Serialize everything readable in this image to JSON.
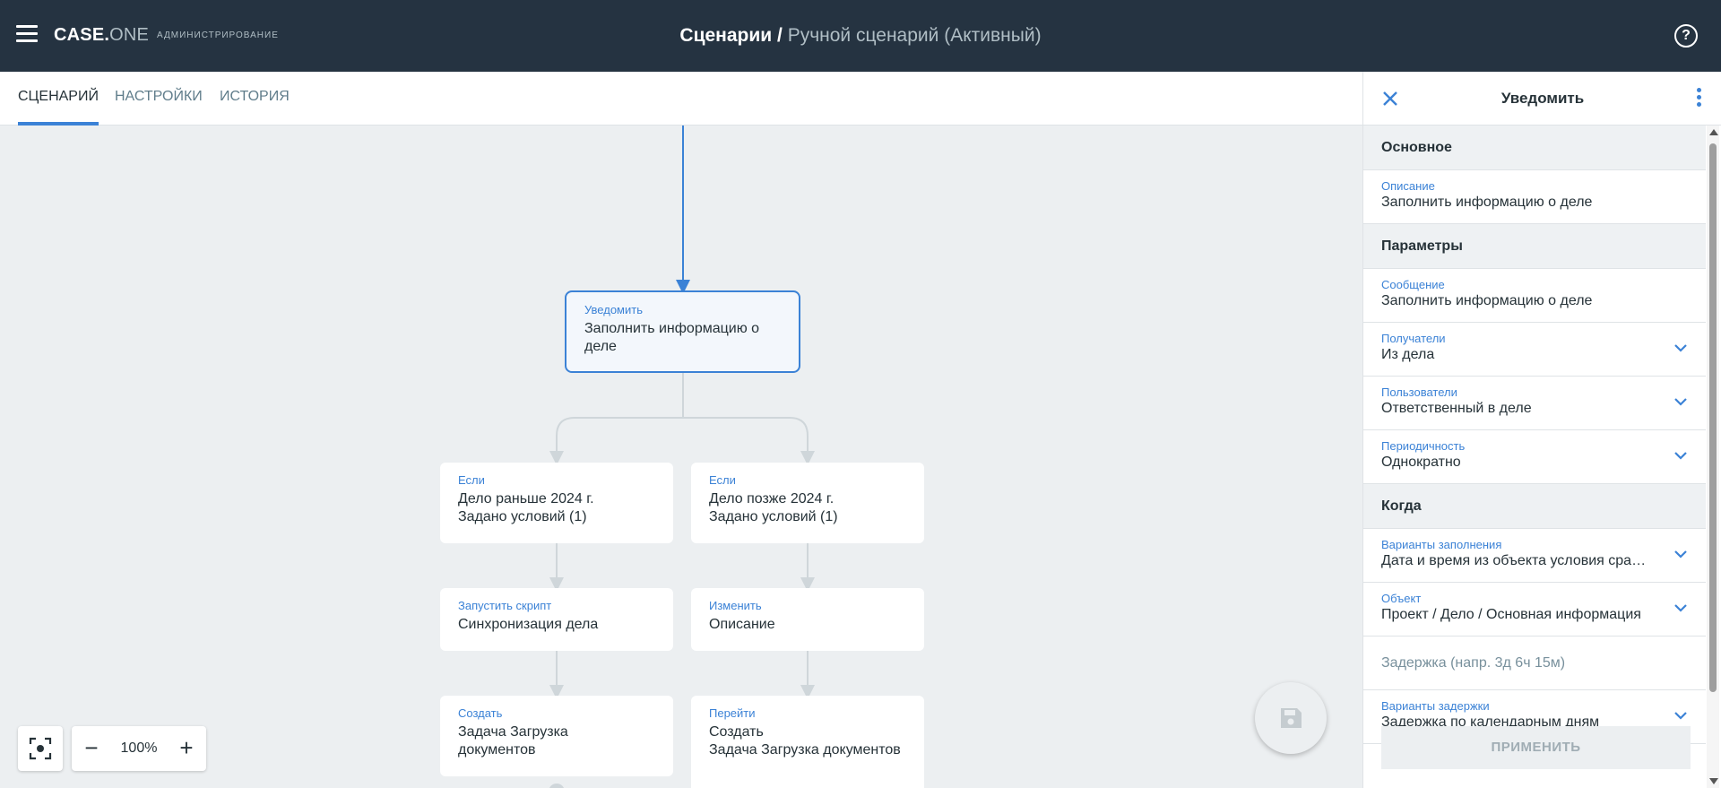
{
  "header": {
    "logo_main": "CASE.",
    "logo_sub": "ONE",
    "section": "АДМИНИСТРИРОВАНИЕ",
    "title_root": "Сценарии",
    "title_sep": " / ",
    "title_sub": "Ручной сценарий (Активный)",
    "menu_icon": "hamburger-icon",
    "help_icon": "help-icon",
    "help_glyph": "?"
  },
  "tabs": [
    {
      "label": "СЦЕНАРИЙ",
      "active": true
    },
    {
      "label": "НАСТРОЙКИ",
      "active": false
    },
    {
      "label": "ИСТОРИЯ",
      "active": false
    }
  ],
  "flow": {
    "nodes": [
      {
        "type": "Уведомить",
        "text": "Заполнить информацию о деле",
        "selected": true
      },
      {
        "type": "Если",
        "text": "Дело раньше 2024 г.\nЗадано условий (1)"
      },
      {
        "type": "Если",
        "text": "Дело позже 2024 г.\nЗадано условий (1)"
      },
      {
        "type": "Запустить скрипт",
        "text": "Синхронизация дела"
      },
      {
        "type": "Изменить",
        "text": "Описание"
      },
      {
        "type": "Создать",
        "text": "Задача Загрузка документов"
      },
      {
        "type": "Перейти",
        "text": "Создать\nЗадача Загрузка документов"
      }
    ]
  },
  "zoom": {
    "level": "100%",
    "minus": "−",
    "plus": "+",
    "fit_icon": "fit-screen-icon"
  },
  "save_icon": "save-icon",
  "panel": {
    "title": "Уведомить",
    "close_icon": "close-icon",
    "menu_icon": "more-vertical-icon",
    "sections": {
      "main": "Основное",
      "params": "Параметры",
      "when": "Когда"
    },
    "description": {
      "label": "Описание",
      "value": "Заполнить информацию о деле"
    },
    "message": {
      "label": "Сообщение",
      "value": "Заполнить информацию о деле"
    },
    "recipients": {
      "label": "Получатели",
      "value": "Из дела"
    },
    "users": {
      "label": "Пользователи",
      "value": "Ответственный в деле"
    },
    "periodicity": {
      "label": "Периодичность",
      "value": "Однократно"
    },
    "fill_variants": {
      "label": "Варианты заполнения",
      "value": "Дата и время из объекта условия срабатывания"
    },
    "object": {
      "label": "Объект",
      "value": "Проект / Дело / Основная информация"
    },
    "delay": {
      "placeholder": "Задержка (напр. 3д 6ч 15м)"
    },
    "delay_variants": {
      "label": "Варианты задержки",
      "value": "Задержка по календарным дням"
    },
    "apply_label": "ПРИМЕНИТЬ"
  },
  "colors": {
    "header_bg": "#253341",
    "accent": "#3b82d6",
    "canvas_bg": "#eceff1"
  }
}
